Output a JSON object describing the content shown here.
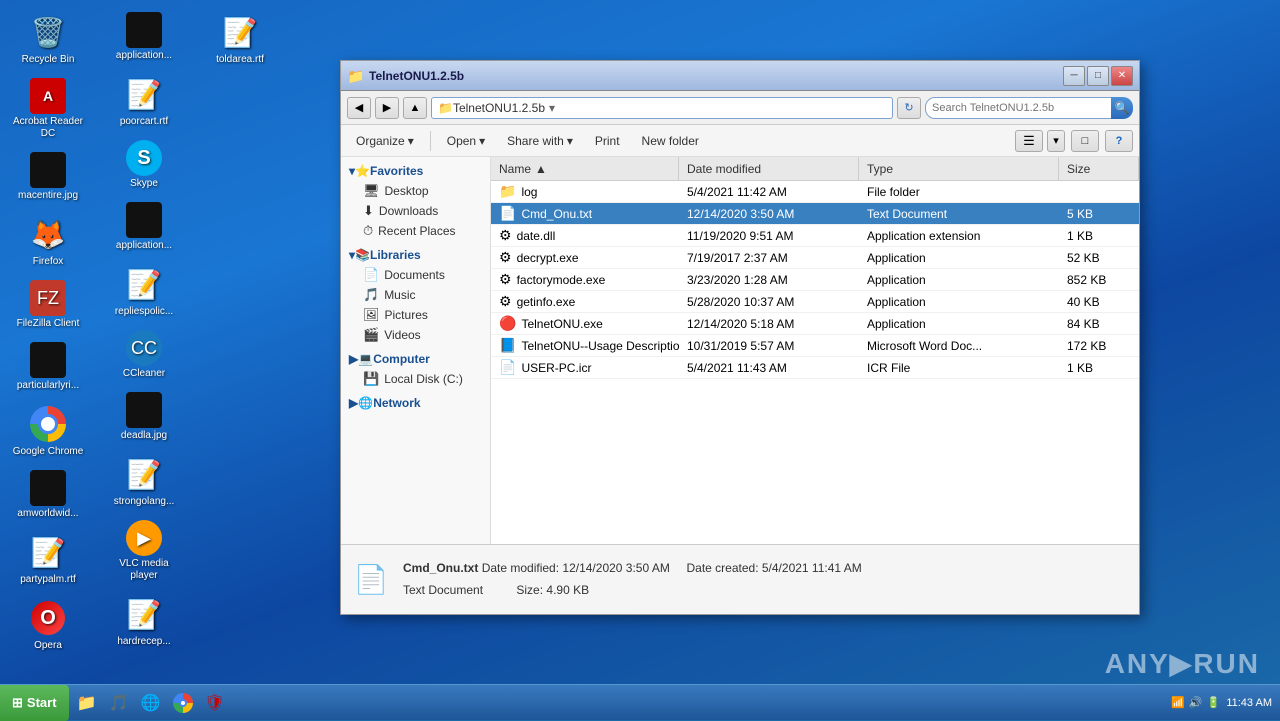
{
  "desktop": {
    "background": "#1565c0",
    "icons": [
      {
        "id": "recycle-bin",
        "label": "Recycle Bin",
        "icon": "🗑️",
        "type": "system"
      },
      {
        "id": "acrobat",
        "label": "Acrobat Reader DC",
        "icon": "📕",
        "type": "app"
      },
      {
        "id": "macentire",
        "label": "macentire.jpg",
        "icon": "🖼️",
        "type": "image"
      },
      {
        "id": "firefox",
        "label": "Firefox",
        "icon": "🦊",
        "type": "browser"
      },
      {
        "id": "filezilla",
        "label": "FileZilla Client",
        "icon": "📁",
        "type": "app"
      },
      {
        "id": "particularlyri",
        "label": "particularlyri...",
        "icon": "🖼️",
        "type": "image"
      },
      {
        "id": "google-chrome",
        "label": "Google Chrome",
        "icon": "chrome",
        "type": "browser"
      },
      {
        "id": "amworldwid",
        "label": "amworldwid...",
        "icon": "📄",
        "type": "doc"
      },
      {
        "id": "partypalmrt",
        "label": "partypalm.rtf",
        "icon": "📝",
        "type": "doc"
      },
      {
        "id": "opera",
        "label": "Opera",
        "icon": "O",
        "type": "browser"
      },
      {
        "id": "application",
        "label": "application...",
        "icon": "📄",
        "type": "file"
      },
      {
        "id": "poorcart",
        "label": "poorcart.rtf",
        "icon": "📝",
        "type": "doc"
      },
      {
        "id": "skype",
        "label": "Skype",
        "icon": "S",
        "type": "app"
      },
      {
        "id": "application2",
        "label": "application...",
        "icon": "📄",
        "type": "file"
      },
      {
        "id": "repliespolic",
        "label": "repliespolic...",
        "icon": "📝",
        "type": "doc"
      },
      {
        "id": "ccleaner",
        "label": "CCleaner",
        "icon": "🧹",
        "type": "app"
      },
      {
        "id": "deadla",
        "label": "deadla.jpg",
        "icon": "🖼️",
        "type": "image"
      },
      {
        "id": "strongolang",
        "label": "strongolang...",
        "icon": "📝",
        "type": "doc"
      },
      {
        "id": "vlc",
        "label": "VLC media player",
        "icon": "▶",
        "type": "app"
      },
      {
        "id": "hardrecep",
        "label": "hardrecep...",
        "icon": "📝",
        "type": "doc"
      },
      {
        "id": "toldarea",
        "label": "toldarea.rtf",
        "icon": "📝",
        "type": "doc"
      }
    ]
  },
  "window": {
    "title": "TelnetONU1.2.5b",
    "path": "TelnetONU1.2.5b",
    "search_placeholder": "Search TelnetONU1.2.5b"
  },
  "toolbar": {
    "organize": "Organize",
    "open": "Open",
    "share_with": "Share with",
    "print": "Print",
    "new_folder": "New folder"
  },
  "nav_pane": {
    "favorites": {
      "label": "Favorites",
      "items": [
        {
          "id": "desktop",
          "label": "Desktop",
          "icon": "🖥"
        },
        {
          "id": "downloads",
          "label": "Downloads",
          "icon": "⬇"
        },
        {
          "id": "recent",
          "label": "Recent Places",
          "icon": "⏱"
        }
      ]
    },
    "libraries": {
      "label": "Libraries",
      "items": [
        {
          "id": "documents",
          "label": "Documents",
          "icon": "📄"
        },
        {
          "id": "music",
          "label": "Music",
          "icon": "🎵"
        },
        {
          "id": "pictures",
          "label": "Pictures",
          "icon": "🖼"
        },
        {
          "id": "videos",
          "label": "Videos",
          "icon": "🎬"
        }
      ]
    },
    "computer": {
      "label": "Computer",
      "items": [
        {
          "id": "local-disk",
          "label": "Local Disk (C:)",
          "icon": "💾"
        }
      ]
    },
    "network": {
      "label": "Network"
    }
  },
  "file_list": {
    "columns": [
      "Name",
      "Date modified",
      "Type",
      "Size"
    ],
    "files": [
      {
        "id": "log",
        "name": "log",
        "date": "5/4/2021 11:42 AM",
        "type": "File folder",
        "size": "",
        "icon": "📁",
        "selected": false
      },
      {
        "id": "cmd-onu-txt",
        "name": "Cmd_Onu.txt",
        "date": "12/14/2020 3:50 AM",
        "type": "Text Document",
        "size": "5 KB",
        "icon": "📄",
        "selected": true
      },
      {
        "id": "date-dll",
        "name": "date.dll",
        "date": "11/19/2020 9:51 AM",
        "type": "Application extension",
        "size": "1 KB",
        "icon": "⚙",
        "selected": false
      },
      {
        "id": "decrypt-exe",
        "name": "decrypt.exe",
        "date": "7/19/2017 2:37 AM",
        "type": "Application",
        "size": "52 KB",
        "icon": "⚙",
        "selected": false
      },
      {
        "id": "factorymode-exe",
        "name": "factorymode.exe",
        "date": "3/23/2020 1:28 AM",
        "type": "Application",
        "size": "852 KB",
        "icon": "⚙",
        "selected": false
      },
      {
        "id": "getinfo-exe",
        "name": "getinfo.exe",
        "date": "5/28/2020 10:37 AM",
        "type": "Application",
        "size": "40 KB",
        "icon": "⚙",
        "selected": false
      },
      {
        "id": "telnetonu-exe",
        "name": "TelnetONU.exe",
        "date": "12/14/2020 5:18 AM",
        "type": "Application",
        "size": "84 KB",
        "icon": "🔴",
        "selected": false
      },
      {
        "id": "telnetonu-doc",
        "name": "TelnetONU--Usage Description of the ONU O...",
        "date": "10/31/2019 5:57 AM",
        "type": "Microsoft Word Doc...",
        "size": "172 KB",
        "icon": "📘",
        "selected": false
      },
      {
        "id": "user-pc-icr",
        "name": "USER-PC.icr",
        "date": "5/4/2021 11:43 AM",
        "type": "ICR File",
        "size": "1 KB",
        "icon": "📄",
        "selected": false
      }
    ]
  },
  "status_bar": {
    "filename": "Cmd_Onu.txt",
    "date_modified_label": "Date modified:",
    "date_modified": "12/14/2020 3:50 AM",
    "date_created_label": "Date created:",
    "date_created": "5/4/2021 11:41 AM",
    "type": "Text Document",
    "size_label": "Size:",
    "size": "4.90 KB"
  },
  "taskbar": {
    "start_label": "Start",
    "time": "11:43 AM"
  },
  "anyrun": {
    "text": "ANY▶RUN"
  }
}
